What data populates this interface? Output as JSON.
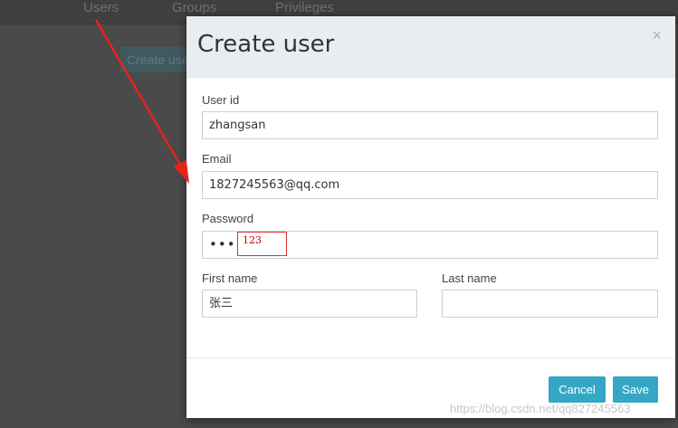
{
  "background": {
    "nav": [
      "Users",
      "Groups",
      "Privileges"
    ],
    "create_button": "Create user"
  },
  "modal": {
    "title": "Create user",
    "close_icon": "×",
    "fields": {
      "user_id": {
        "label": "User id",
        "value": "zhangsan"
      },
      "email": {
        "label": "Email",
        "value": "1827245563@qq.com"
      },
      "password": {
        "label": "Password",
        "value_masked": "•••"
      },
      "first_name": {
        "label": "First name",
        "value": "张三"
      },
      "last_name": {
        "label": "Last name",
        "value": ""
      }
    },
    "buttons": {
      "cancel": "Cancel",
      "save": "Save"
    }
  },
  "annotation": {
    "password_note": "123",
    "arrow_color": "#e8221c"
  },
  "watermark": "https://blog.csdn.net/qq827245563",
  "colors": {
    "accent": "#35a7c4",
    "overlay": "#4a4a4a"
  }
}
